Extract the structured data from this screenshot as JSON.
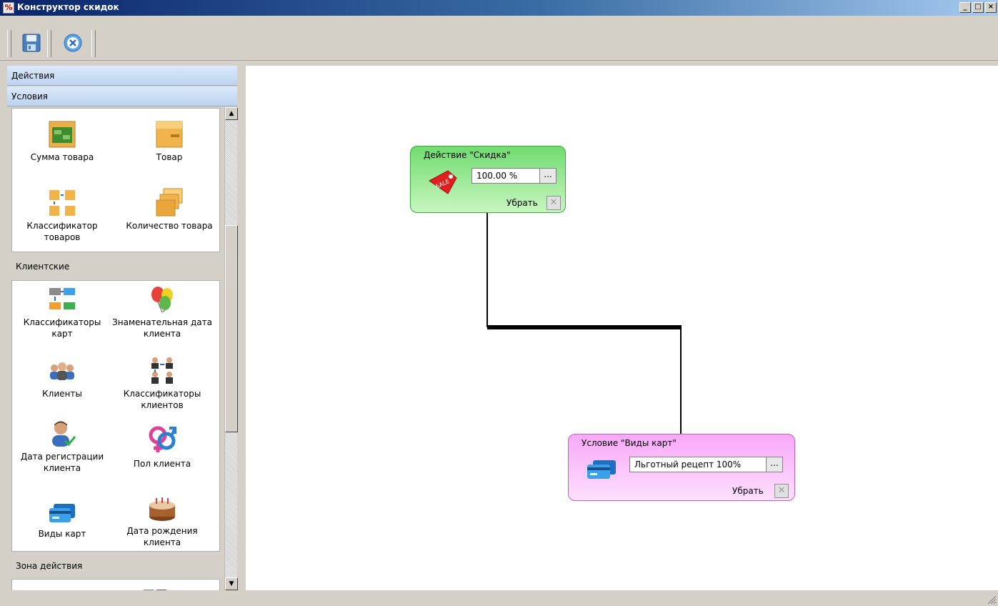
{
  "window": {
    "title": "Конструктор скидок",
    "app_icon": "%",
    "controls": [
      "_",
      "□",
      "×"
    ]
  },
  "toolbar": {
    "buttons": [
      {
        "name": "save",
        "icon": "floppy-disk-icon"
      },
      {
        "name": "cancel",
        "icon": "close-circle-icon"
      }
    ]
  },
  "palette": {
    "categories": [
      "Действия",
      "Условия"
    ],
    "groups": [
      {
        "name": "",
        "items": [
          {
            "label": "Сумма товара",
            "icon": "money-box-icon"
          },
          {
            "label": "Товар",
            "icon": "box-icon"
          },
          {
            "label": "Классификатор товаров",
            "icon": "boxes-classifier-icon"
          },
          {
            "label": "Количество товара",
            "icon": "stacked-boxes-icon"
          }
        ]
      },
      {
        "name": "Клиентские",
        "items": [
          {
            "label": "Классификаторы карт",
            "icon": "cards-classifier-icon"
          },
          {
            "label": "Знаменательная дата клиента",
            "icon": "balloons-icon"
          },
          {
            "label": "Клиенты",
            "icon": "people-group-icon"
          },
          {
            "label": "Классификаторы клиентов",
            "icon": "people-classifier-icon"
          },
          {
            "label": "Дата регистрации клиента",
            "icon": "user-check-icon"
          },
          {
            "label": "Пол клиента",
            "icon": "gender-icon"
          },
          {
            "label": "Виды карт",
            "icon": "credit-card-icon"
          },
          {
            "label": "Дата рождения клиента",
            "icon": "cake-icon"
          }
        ]
      },
      {
        "name": "Зона действия",
        "items": []
      }
    ]
  },
  "canvas": {
    "nodes": [
      {
        "title": "Действие \"Скидка\"",
        "value": "100.00 %",
        "browse_label": "...",
        "remove_label": "Убрать",
        "icon": "sale-tag-icon",
        "color": "#7ee07e"
      },
      {
        "title": "Условие \"Виды карт\"",
        "value": "Льготный рецепт 100%",
        "browse_label": "...",
        "remove_label": "Убрать",
        "icon": "credit-card-icon",
        "color": "#f7b8f7"
      }
    ]
  }
}
